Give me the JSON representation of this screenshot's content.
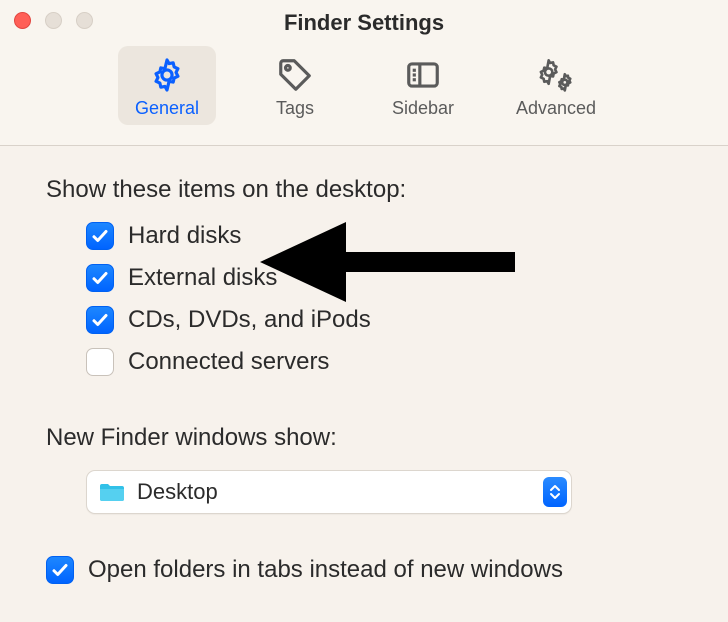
{
  "window": {
    "title": "Finder Settings"
  },
  "tabs": {
    "general": "General",
    "tags": "Tags",
    "sidebar": "Sidebar",
    "advanced": "Advanced"
  },
  "sections": {
    "desktop_items_label": "Show these items on the desktop:",
    "new_finder_label": "New Finder windows show:"
  },
  "desktop_items": {
    "hard_disks": {
      "label": "Hard disks",
      "checked": true
    },
    "external": {
      "label": "External disks",
      "checked": true
    },
    "cds": {
      "label": "CDs, DVDs, and iPods",
      "checked": true
    },
    "servers": {
      "label": "Connected servers",
      "checked": false
    }
  },
  "new_finder_dropdown": {
    "value": "Desktop"
  },
  "tabs_checkbox": {
    "label": "Open folders in tabs instead of new windows",
    "checked": true
  }
}
